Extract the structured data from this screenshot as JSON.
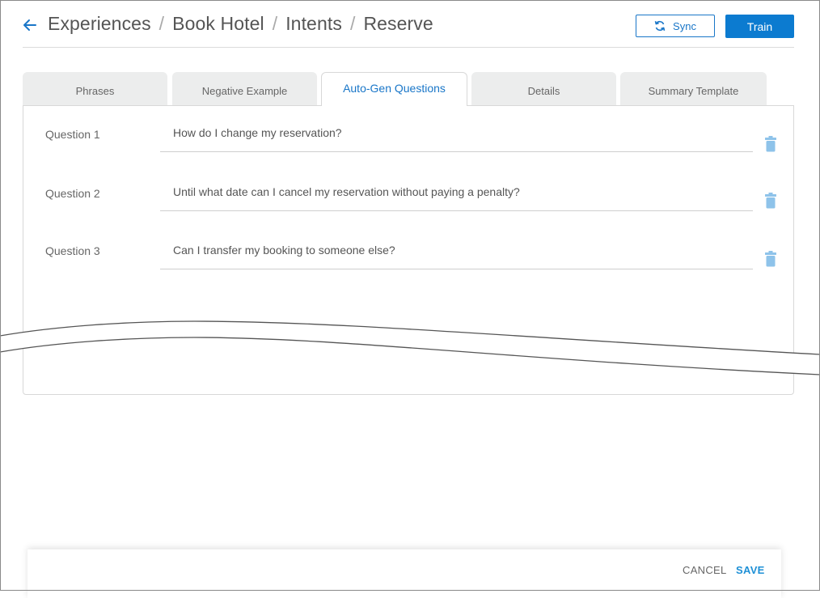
{
  "breadcrumb": {
    "items": [
      "Experiences",
      "Book Hotel",
      "Intents",
      "Reserve"
    ],
    "separator": "/"
  },
  "toolbar": {
    "sync_label": "Sync",
    "train_label": "Train"
  },
  "tabs": [
    {
      "label": "Phrases",
      "active": false
    },
    {
      "label": "Negative Example",
      "active": false
    },
    {
      "label": "Auto-Gen Questions",
      "active": true
    },
    {
      "label": "Details",
      "active": false
    },
    {
      "label": "Summary Template",
      "active": false
    }
  ],
  "questions": [
    {
      "label": "Question 1",
      "value": "How do I change my reservation?"
    },
    {
      "label": "Question 2",
      "value": "Until what date can I cancel my reservation without paying a penalty?"
    },
    {
      "label": "Question 3",
      "value": "Can I transfer my booking to someone else?"
    }
  ],
  "footer": {
    "cancel_label": "CANCEL",
    "save_label": "SAVE"
  },
  "colors": {
    "accent": "#1976c8",
    "train_button": "#0c7bd0",
    "trash_icon": "#8ec3ea",
    "save_text": "#1e90d6"
  },
  "icons": {
    "back": "arrow-left-icon",
    "sync": "sync-icon",
    "delete": "trash-icon"
  }
}
